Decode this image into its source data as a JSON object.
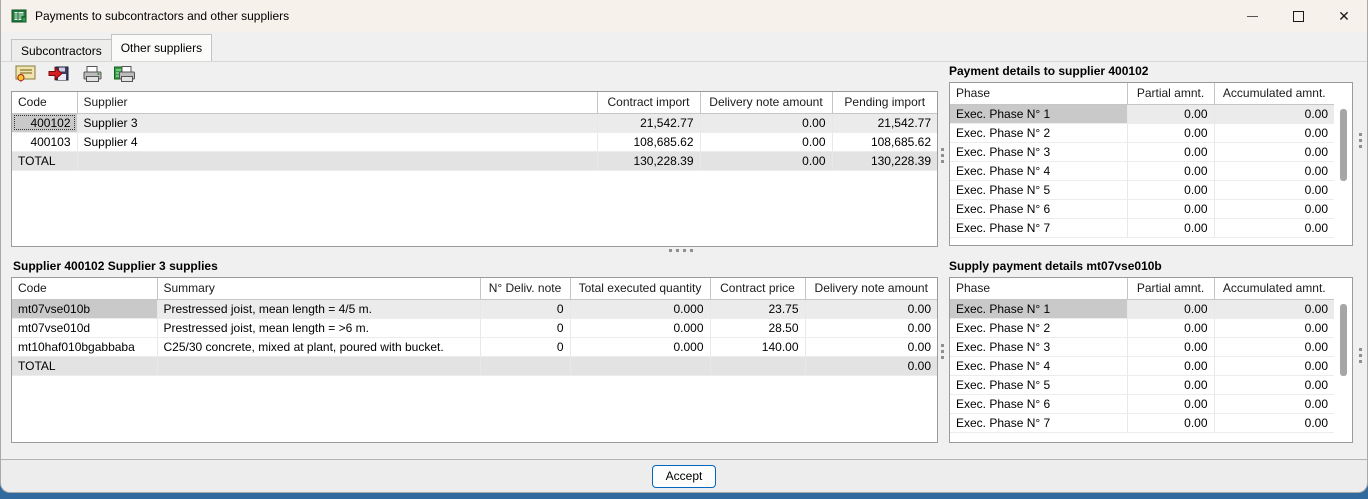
{
  "window": {
    "title": "Payments to subcontractors and other suppliers",
    "controls": [
      "minimize",
      "maximize",
      "close"
    ]
  },
  "tabs": [
    {
      "label": "Subcontractors",
      "active": false
    },
    {
      "label": "Other suppliers",
      "active": true
    }
  ],
  "toolbar": {
    "icons": [
      "certificate-icon",
      "save-export-icon",
      "print-icon",
      "print-preview-icon"
    ]
  },
  "suppliers_table": {
    "headers": {
      "code": "Code",
      "supplier": "Supplier",
      "contract_import": "Contract import",
      "delivery_note_amount": "Delivery note amount",
      "pending_import": "Pending import"
    },
    "rows": [
      {
        "code": "400102",
        "supplier": "Supplier 3",
        "contract_import": "21,542.77",
        "delivery_note_amount": "0.00",
        "pending_import": "21,542.77"
      },
      {
        "code": "400103",
        "supplier": "Supplier 4",
        "contract_import": "108,685.62",
        "delivery_note_amount": "0.00",
        "pending_import": "108,685.62"
      },
      {
        "code": "TOTAL",
        "supplier": "",
        "contract_import": "130,228.39",
        "delivery_note_amount": "0.00",
        "pending_import": "130,228.39"
      }
    ]
  },
  "payment_details": {
    "title": "Payment details to supplier 400102",
    "headers": {
      "phase": "Phase",
      "partial": "Partial amnt.",
      "accumulated": "Accumulated amnt."
    },
    "rows": [
      {
        "phase": "Exec. Phase N° 1",
        "partial": "0.00",
        "accumulated": "0.00"
      },
      {
        "phase": "Exec. Phase N° 2",
        "partial": "0.00",
        "accumulated": "0.00"
      },
      {
        "phase": "Exec. Phase N° 3",
        "partial": "0.00",
        "accumulated": "0.00"
      },
      {
        "phase": "Exec. Phase N° 4",
        "partial": "0.00",
        "accumulated": "0.00"
      },
      {
        "phase": "Exec. Phase N° 5",
        "partial": "0.00",
        "accumulated": "0.00"
      },
      {
        "phase": "Exec. Phase N° 6",
        "partial": "0.00",
        "accumulated": "0.00"
      },
      {
        "phase": "Exec. Phase N° 7",
        "partial": "0.00",
        "accumulated": "0.00"
      }
    ]
  },
  "supplies_table": {
    "title": "Supplier 400102 Supplier 3 supplies",
    "headers": {
      "code": "Code",
      "summary": "Summary",
      "deliv_note": "N° Deliv. note",
      "total_executed": "Total executed quantity",
      "contract_price": "Contract price",
      "delivery_note_amount": "Delivery note amount"
    },
    "rows": [
      {
        "code": "mt07vse010b",
        "summary": "Prestressed joist, mean length = 4/5 m.",
        "deliv_note": "0",
        "total_executed": "0.000",
        "contract_price": "23.75",
        "delivery_note_amount": "0.00"
      },
      {
        "code": "mt07vse010d",
        "summary": "Prestressed joist, mean length = >6 m.",
        "deliv_note": "0",
        "total_executed": "0.000",
        "contract_price": "28.50",
        "delivery_note_amount": "0.00"
      },
      {
        "code": "mt10haf010bgabbaba",
        "summary": "C25/30 concrete, mixed at plant, poured with bucket.",
        "deliv_note": "0",
        "total_executed": "0.000",
        "contract_price": "140.00",
        "delivery_note_amount": "0.00"
      },
      {
        "code": "TOTAL",
        "summary": "",
        "deliv_note": "",
        "total_executed": "",
        "contract_price": "",
        "delivery_note_amount": "0.00"
      }
    ]
  },
  "supply_details": {
    "title": "Supply payment details mt07vse010b",
    "headers": {
      "phase": "Phase",
      "partial": "Partial amnt.",
      "accumulated": "Accumulated amnt."
    },
    "rows": [
      {
        "phase": "Exec. Phase N° 1",
        "partial": "0.00",
        "accumulated": "0.00"
      },
      {
        "phase": "Exec. Phase N° 2",
        "partial": "0.00",
        "accumulated": "0.00"
      },
      {
        "phase": "Exec. Phase N° 3",
        "partial": "0.00",
        "accumulated": "0.00"
      },
      {
        "phase": "Exec. Phase N° 4",
        "partial": "0.00",
        "accumulated": "0.00"
      },
      {
        "phase": "Exec. Phase N° 5",
        "partial": "0.00",
        "accumulated": "0.00"
      },
      {
        "phase": "Exec. Phase N° 6",
        "partial": "0.00",
        "accumulated": "0.00"
      },
      {
        "phase": "Exec. Phase N° 7",
        "partial": "0.00",
        "accumulated": "0.00"
      }
    ]
  },
  "footer": {
    "accept": "Accept"
  },
  "colors": {
    "accent_button_border": "#0067c0",
    "selected_cell": "#c9c9c9",
    "selected_row": "#ebebeb",
    "total_row": "#e3e3e3",
    "titlebar_bg": "#f6f1ea",
    "dialog_bg": "#f0f0f0",
    "bottom_strip": "#306a9e"
  }
}
